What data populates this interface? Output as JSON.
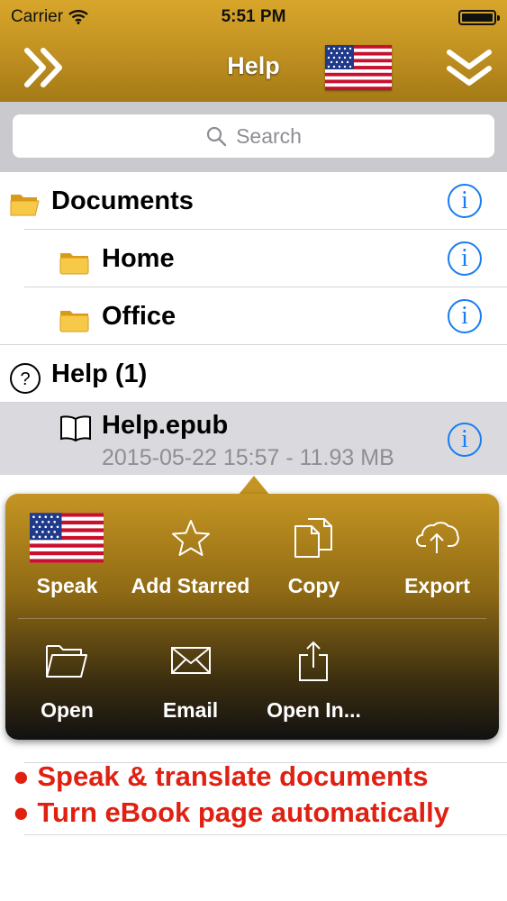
{
  "status_bar": {
    "carrier": "Carrier",
    "time": "5:51 PM"
  },
  "nav": {
    "title": "Help",
    "left_icon": "double-chevron-right-icon",
    "right_icon": "double-chevron-down-icon",
    "flag": "us-flag-icon"
  },
  "search": {
    "placeholder": "Search"
  },
  "list": {
    "documents": "Documents",
    "home": "Home",
    "office": "Office",
    "help_group": "Help (1)",
    "file_name": "Help.epub",
    "file_meta": "2015-05-22 15:57 - 11.93 MB"
  },
  "popover": {
    "speak": "Speak",
    "add_starred": "Add Starred",
    "copy": "Copy",
    "export": "Export",
    "open": "Open",
    "email": "Email",
    "open_in": "Open In..."
  },
  "promo": {
    "line1": "● Speak & translate documents",
    "line2": "● Turn eBook page automatically"
  },
  "colors": {
    "accent": "#c49423",
    "info_blue": "#1a7cf2",
    "promo_red": "#e02011"
  }
}
